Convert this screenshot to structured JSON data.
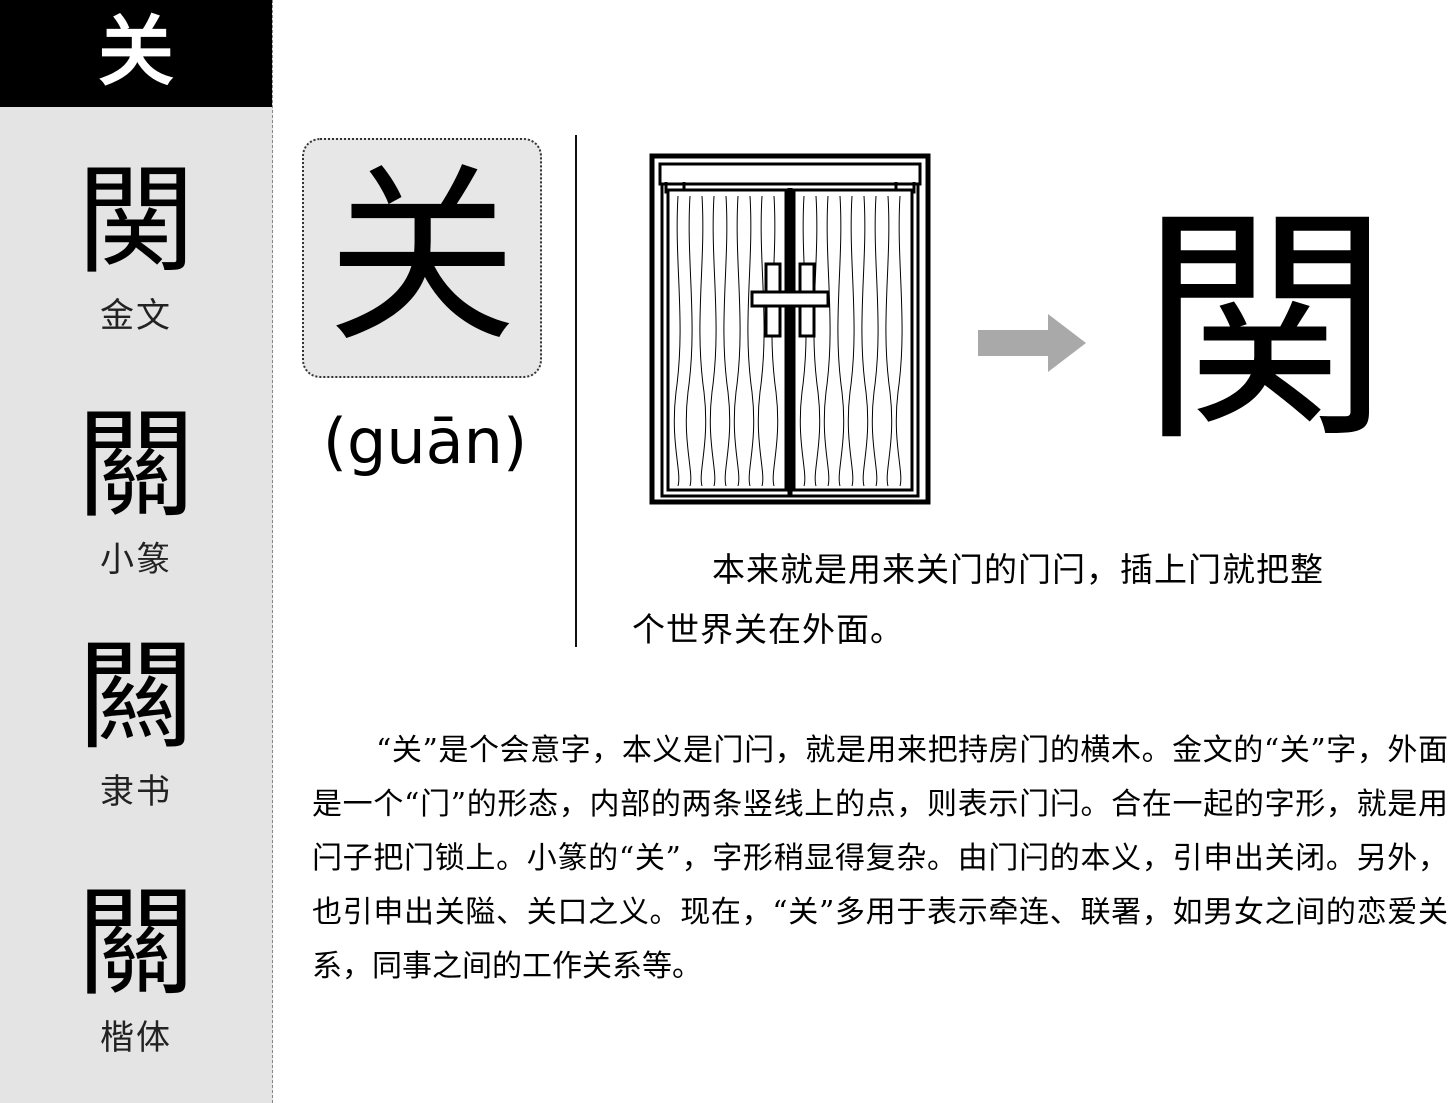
{
  "sidebar": {
    "header_char": "关",
    "items": [
      {
        "glyph": "関",
        "label": "金文"
      },
      {
        "glyph": "關",
        "label": "小篆"
      },
      {
        "glyph": "闗",
        "label": "隶书"
      },
      {
        "glyph": "關",
        "label": "楷体"
      }
    ]
  },
  "main": {
    "character": "关",
    "pinyin": "(guān)",
    "illustration": "door-with-latch-icon",
    "ancient_form": "関",
    "caption": "本来就是用来关门的门闩，插上门就把整个世界关在外面。",
    "paragraph": "“关”是个会意字，本义是门闩，就是用来把持房门的横木。金文的“关”字，外面是一个“门”的形态，内部的两条竖线上的点，则表示门闩。合在一起的字形，就是用闩子把门锁上。小篆的“关”，字形稍显得复杂。由门闩的本义，引申出关闭。另外，也引申出关隘、关口之义。现在，“关”多用于表示牵连、联署，如男女之间的恋爱关系，同事之间的工作关系等。"
  }
}
